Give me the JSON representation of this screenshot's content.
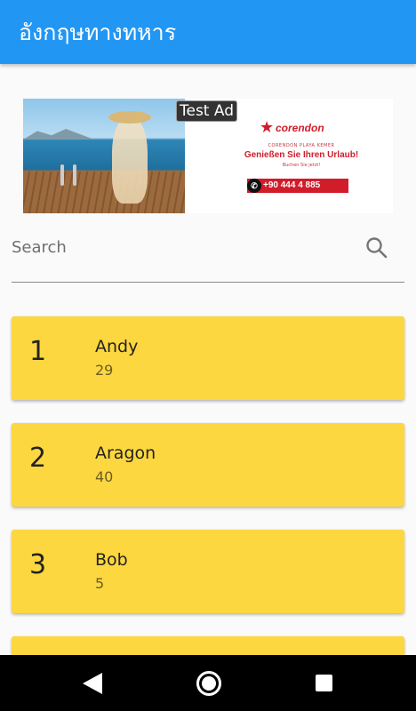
{
  "app": {
    "title": "อังกฤษทางทหาร",
    "primary_color": "#2196f3",
    "card_color": "#fdd73f"
  },
  "ad": {
    "label": "Test Ad",
    "brand": "corendon",
    "small_line_1": "CORENDON PLAYA KEMER",
    "headline": "Genießen Sie Ihren Urlaub!",
    "small_line_2": "Buchen Sie jetzt!",
    "phone": "+90 444 4 885"
  },
  "search": {
    "placeholder": "Search",
    "value": "",
    "icon": "search-icon"
  },
  "list": [
    {
      "number": "1",
      "name": "Andy",
      "sub": "29"
    },
    {
      "number": "2",
      "name": "Aragon",
      "sub": "40"
    },
    {
      "number": "3",
      "name": "Bob",
      "sub": "5"
    },
    {
      "number": "",
      "name": "",
      "sub": ""
    }
  ],
  "navbar": {
    "back": "back-icon",
    "home": "home-icon",
    "recents": "recents-icon"
  }
}
